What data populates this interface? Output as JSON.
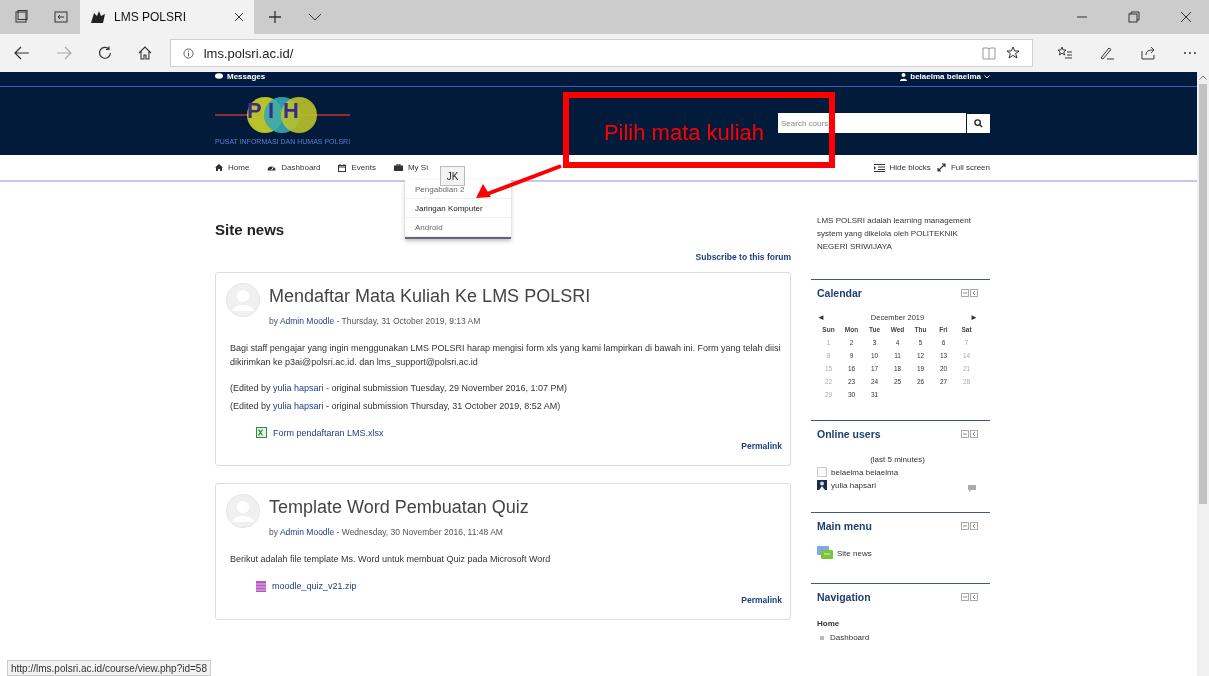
{
  "browser": {
    "tab_title": "LMS POLSRI",
    "url": "lms.polsri.ac.id/"
  },
  "topbar": {
    "messages": "Messages",
    "user": "belaelma belaelma"
  },
  "header": {
    "logo_letters": [
      "P",
      "I",
      "H"
    ],
    "logo_caption": "PUSAT INFORMASI DAN HUMAS POLSRI",
    "search_placeholder": "Search cours"
  },
  "nav": {
    "items": [
      {
        "label": "Home",
        "kind": "home"
      },
      {
        "label": "Dashboard",
        "kind": "dashboard"
      },
      {
        "label": "Events",
        "kind": "events"
      },
      {
        "label": "My Si",
        "kind": "sites"
      }
    ],
    "tooltip": "JK",
    "right": [
      {
        "label": "Hide blocks",
        "kind": "hide"
      },
      {
        "label": "Full screen",
        "kind": "fullscreen"
      }
    ]
  },
  "dropdown": [
    {
      "label": "Pengabdian 2",
      "selected": false
    },
    {
      "label": "Jaringan Komputer",
      "selected": true
    },
    {
      "label": "Android",
      "selected": false
    }
  ],
  "annotation": {
    "text": "Pilih mata kuliah"
  },
  "main": {
    "title": "Site news",
    "subscribe": "Subscribe to this forum",
    "posts": [
      {
        "title": "Mendaftar Mata Kuliah Ke LMS POLSRI",
        "by": "by",
        "author": "Admin Moodle",
        "date": "- Thursday, 31 October 2019, 9:13 AM",
        "body": "Bagi staff pengajar yang ingin menggunakan LMS POLSRI harap mengisi form xls yang kami lampirkan di bawah ini. Form yang telah diisi dikirimkan ke p3ai@polsri.ac.id. dan lms_support@polsri.ac.id",
        "edits": [
          {
            "prefix": "(Edited by",
            "editor": "yulia hapsari",
            "rest": "- original submission Tuesday, 29 November 2016, 1:07 PM)"
          },
          {
            "prefix": "(Edited by",
            "editor": "yulia hapsari",
            "rest": "- original submission Thursday, 31 October 2019, 8:52 AM)"
          }
        ],
        "attachment": {
          "name": "Form pendaftaran LMS.xlsx",
          "kind": "xlsx"
        },
        "permalink": "Permalink"
      },
      {
        "title": "Template Word Pembuatan Quiz",
        "by": "by",
        "author": "Admin Moodle",
        "date": "- Wednesday, 30 November 2016, 11:48 AM",
        "body": "Berikut adalah file template Ms. Word untuk membuat Quiz pada Microsoft Word",
        "attachment": {
          "name": "moodle_quiz_v21.zip",
          "kind": "zip"
        },
        "permalink": "Permalink"
      }
    ]
  },
  "sidebar": {
    "about": "LMS POLSRI adalah learning management system yang dikelola oleh POLITEKNIK NEGERI SRIWIJAYA",
    "calendar": {
      "title": "Calendar",
      "prev": "◄",
      "next": "►",
      "month": "December 2019",
      "weekdays": [
        "Sun",
        "Mon",
        "Tue",
        "Wed",
        "Thu",
        "Fri",
        "Sat"
      ],
      "weeks": [
        [
          {
            "day": "1",
            "weekend": true
          },
          {
            "day": "2",
            "weekend": false
          },
          {
            "day": "3",
            "weekend": false
          },
          {
            "day": "4",
            "weekend": false
          },
          {
            "day": "5",
            "weekend": false
          },
          {
            "day": "6",
            "weekend": false
          },
          {
            "day": "7",
            "weekend": true
          }
        ],
        [
          {
            "day": "8",
            "weekend": true
          },
          {
            "day": "9",
            "weekend": false
          },
          {
            "day": "10",
            "weekend": false
          },
          {
            "day": "11",
            "weekend": false
          },
          {
            "day": "12",
            "weekend": false
          },
          {
            "day": "13",
            "weekend": false
          },
          {
            "day": "14",
            "weekend": true
          }
        ],
        [
          {
            "day": "15",
            "weekend": true
          },
          {
            "day": "16",
            "weekend": false
          },
          {
            "day": "17",
            "weekend": false
          },
          {
            "day": "18",
            "weekend": false
          },
          {
            "day": "19",
            "weekend": false
          },
          {
            "day": "20",
            "weekend": false
          },
          {
            "day": "21",
            "weekend": true
          }
        ],
        [
          {
            "day": "22",
            "weekend": true
          },
          {
            "day": "23",
            "weekend": false
          },
          {
            "day": "24",
            "weekend": false
          },
          {
            "day": "25",
            "weekend": false
          },
          {
            "day": "26",
            "weekend": false
          },
          {
            "day": "27",
            "weekend": false
          },
          {
            "day": "28",
            "weekend": true
          }
        ],
        [
          {
            "day": "29",
            "weekend": true
          },
          {
            "day": "30",
            "weekend": false
          },
          {
            "day": "31",
            "weekend": false
          }
        ]
      ]
    },
    "online": {
      "title": "Online users",
      "note": "(last 5 minutes)",
      "users": [
        {
          "name": "belaelma belaelma",
          "kind": "blank"
        },
        {
          "name": "yulia hapsari",
          "kind": "photo"
        }
      ]
    },
    "main_menu": {
      "title": "Main menu",
      "items": [
        "Site news"
      ]
    },
    "navigation": {
      "title": "Navigation",
      "home": "Home",
      "items": [
        "Dashboard"
      ]
    }
  },
  "status_url": "http://lms.polsri.ac.id/course/view.php?id=58"
}
